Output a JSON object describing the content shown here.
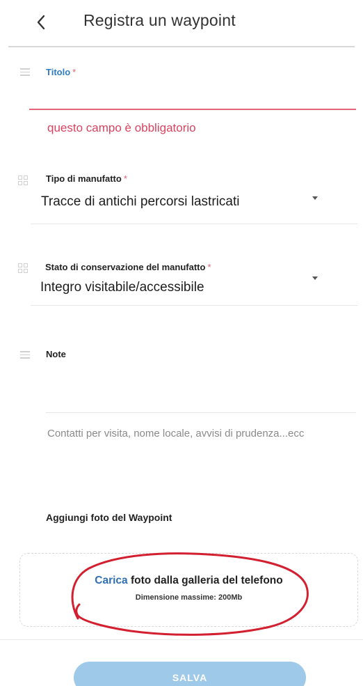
{
  "header": {
    "title": "Registra un waypoint"
  },
  "form": {
    "titolo": {
      "label": "Titolo",
      "required_mark": "*",
      "value": "",
      "error": "questo campo è obbligatorio"
    },
    "tipo_manufatto": {
      "label": "Tipo di manufatto",
      "required_mark": "*",
      "selected": "Tracce di antichi percorsi lastricati"
    },
    "stato_conservazione": {
      "label": "Stato di conservazione del manufatto",
      "required_mark": "*",
      "selected": "Integro visitabile/accessibile"
    },
    "note": {
      "label": "Note",
      "placeholder": "Contatti per visita, nome locale, avvisi di prudenza...ecc"
    }
  },
  "photos": {
    "section_title": "Aggiungi foto del Waypoint",
    "upload_link": "Carica",
    "upload_text": "foto dalla galleria del telefono",
    "size_limit": "Dimensione massime: 200Mb"
  },
  "footer": {
    "save_label": "SALVA"
  },
  "colors": {
    "accent": "#2f7cc2",
    "error": "#e0607a",
    "save_button": "#9ec9e8",
    "annotation": "#d32030"
  },
  "icons": {
    "back": "chevron-left-icon",
    "text_field": "lines-icon",
    "select_field": "grid-icon",
    "dropdown": "caret-down-icon"
  }
}
